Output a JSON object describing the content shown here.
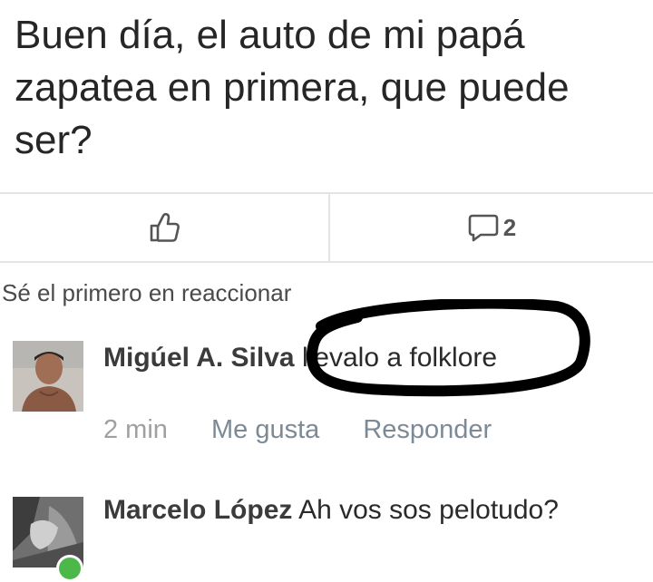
{
  "post": {
    "text": "Buen día, el auto de mi papá zapatea en primera, que puede ser?"
  },
  "actions": {
    "like_icon": "thumbs-up-icon",
    "comment_icon": "comment-icon",
    "comment_count": "2"
  },
  "reactions_prompt": "Sé el primero en reaccionar",
  "comments": [
    {
      "author": "Migúel A. Silva",
      "text": "llevalo a folklore",
      "time": "2 min",
      "like_label": "Me gusta",
      "reply_label": "Responder"
    },
    {
      "author": "Marcelo López",
      "text": "Ah vos sos pelotudo?"
    }
  ],
  "colors": {
    "divider": "#e4e4e4",
    "annotation": "#000000",
    "online": "#4cb84a"
  }
}
